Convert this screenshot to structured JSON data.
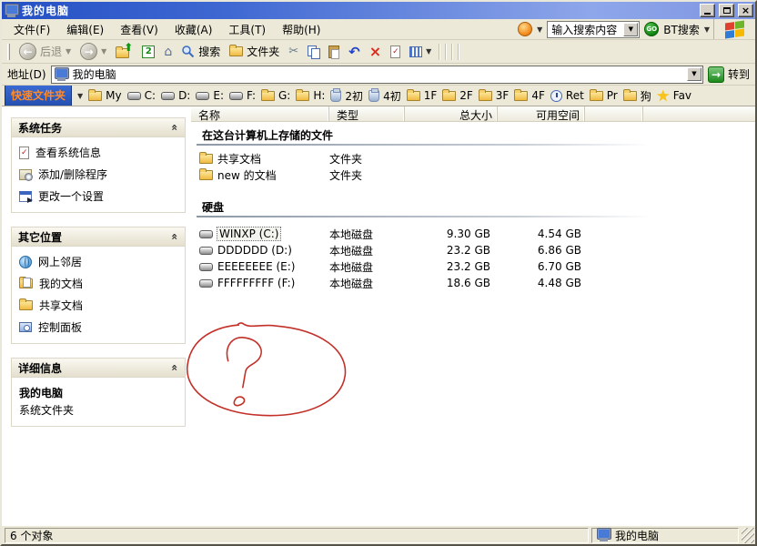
{
  "window": {
    "title": "我的电脑"
  },
  "menu": {
    "items": [
      "文件(F)",
      "编辑(E)",
      "查看(V)",
      "收藏(A)",
      "工具(T)",
      "帮助(H)"
    ],
    "search": {
      "engine_icon": "orange-circle-icon",
      "value": "输入搜索内容",
      "go_label": "GO",
      "bt_label": "BT搜索"
    }
  },
  "toolbar": {
    "back_label": "后退",
    "search_label": "搜索",
    "folders_label": "文件夹",
    "icons": [
      "back-icon",
      "forward-icon",
      "up-icon",
      "plugin-2-icon",
      "home-icon",
      "search-icon",
      "folders-icon",
      "cut-icon",
      "copy-icon",
      "paste-icon",
      "undo-icon",
      "delete-icon",
      "checkmark-doc-icon",
      "views-icon"
    ]
  },
  "addressbar": {
    "label": "地址(D)",
    "value": "我的电脑",
    "go_label": "转到"
  },
  "quickbar": {
    "button_label": "快速文件夹",
    "items": [
      {
        "label": "My",
        "icon": "folder-icon"
      },
      {
        "label": "C:",
        "icon": "disk-icon"
      },
      {
        "label": "D:",
        "icon": "disk-icon"
      },
      {
        "label": "E:",
        "icon": "disk-icon"
      },
      {
        "label": "F:",
        "icon": "disk-icon"
      },
      {
        "label": "G:",
        "icon": "folder-icon"
      },
      {
        "label": "H:",
        "icon": "folder-icon"
      },
      {
        "label": "2初",
        "icon": "jar-icon"
      },
      {
        "label": "4初",
        "icon": "jar-icon"
      },
      {
        "label": "1F",
        "icon": "folder-icon"
      },
      {
        "label": "2F",
        "icon": "folder-icon"
      },
      {
        "label": "3F",
        "icon": "folder-icon"
      },
      {
        "label": "4F",
        "icon": "folder-icon"
      },
      {
        "label": "Ret",
        "icon": "clock-icon"
      },
      {
        "label": "Pr",
        "icon": "folder-icon"
      },
      {
        "label": "狗",
        "icon": "folder-icon"
      },
      {
        "label": "Fav",
        "icon": "star-icon"
      }
    ]
  },
  "sidebar": {
    "system_tasks": {
      "title": "系统任务",
      "items": [
        {
          "label": "查看系统信息",
          "icon": "system-info-icon"
        },
        {
          "label": "添加/删除程序",
          "icon": "add-remove-icon"
        },
        {
          "label": "更改一个设置",
          "icon": "change-setting-icon"
        }
      ]
    },
    "other_places": {
      "title": "其它位置",
      "items": [
        {
          "label": "网上邻居",
          "icon": "network-places-icon"
        },
        {
          "label": "我的文档",
          "icon": "my-documents-icon"
        },
        {
          "label": "共享文档",
          "icon": "shared-documents-icon"
        },
        {
          "label": "控制面板",
          "icon": "control-panel-icon"
        }
      ]
    },
    "details": {
      "title": "详细信息",
      "name": "我的电脑",
      "desc": "系统文件夹"
    }
  },
  "content": {
    "columns": [
      "名称",
      "类型",
      "总大小",
      "可用空间"
    ],
    "files_group": {
      "title": "在这台计算机上存储的文件",
      "rows": [
        {
          "name": "共享文档",
          "type": "文件夹",
          "icon": "folder-icon"
        },
        {
          "name": "new 的文档",
          "type": "文件夹",
          "icon": "folder-icon"
        }
      ]
    },
    "drives_group": {
      "title": "硬盘",
      "rows": [
        {
          "name": "WINXP (C:)",
          "type": "本地磁盘",
          "size": "9.30 GB",
          "free": "4.54 GB",
          "selected": true,
          "icon": "disk-icon"
        },
        {
          "name": "DDDDDD (D:)",
          "type": "本地磁盘",
          "size": "23.2 GB",
          "free": "6.86 GB",
          "selected": false,
          "icon": "disk-icon"
        },
        {
          "name": "EEEEEEEE (E:)",
          "type": "本地磁盘",
          "size": "23.2 GB",
          "free": "6.70 GB",
          "selected": false,
          "icon": "disk-icon"
        },
        {
          "name": "FFFFFFFFF (F:)",
          "type": "本地磁盘",
          "size": "18.6 GB",
          "free": "4.48 GB",
          "selected": false,
          "icon": "disk-icon"
        }
      ]
    },
    "annotation": {
      "shape": "hand-drawn red ellipse with question mark",
      "color": "#c23028"
    }
  },
  "statusbar": {
    "objects_label": "6 个对象",
    "location_label": "我的电脑"
  },
  "colors": {
    "titlebar_start": "#2450c4",
    "titlebar_end": "#8ea6ea",
    "chrome": "#ece9d8",
    "quick_button_bg": "#2e5ec6",
    "quick_button_text": "#ff8a2a",
    "annotation_red": "#c23028"
  }
}
